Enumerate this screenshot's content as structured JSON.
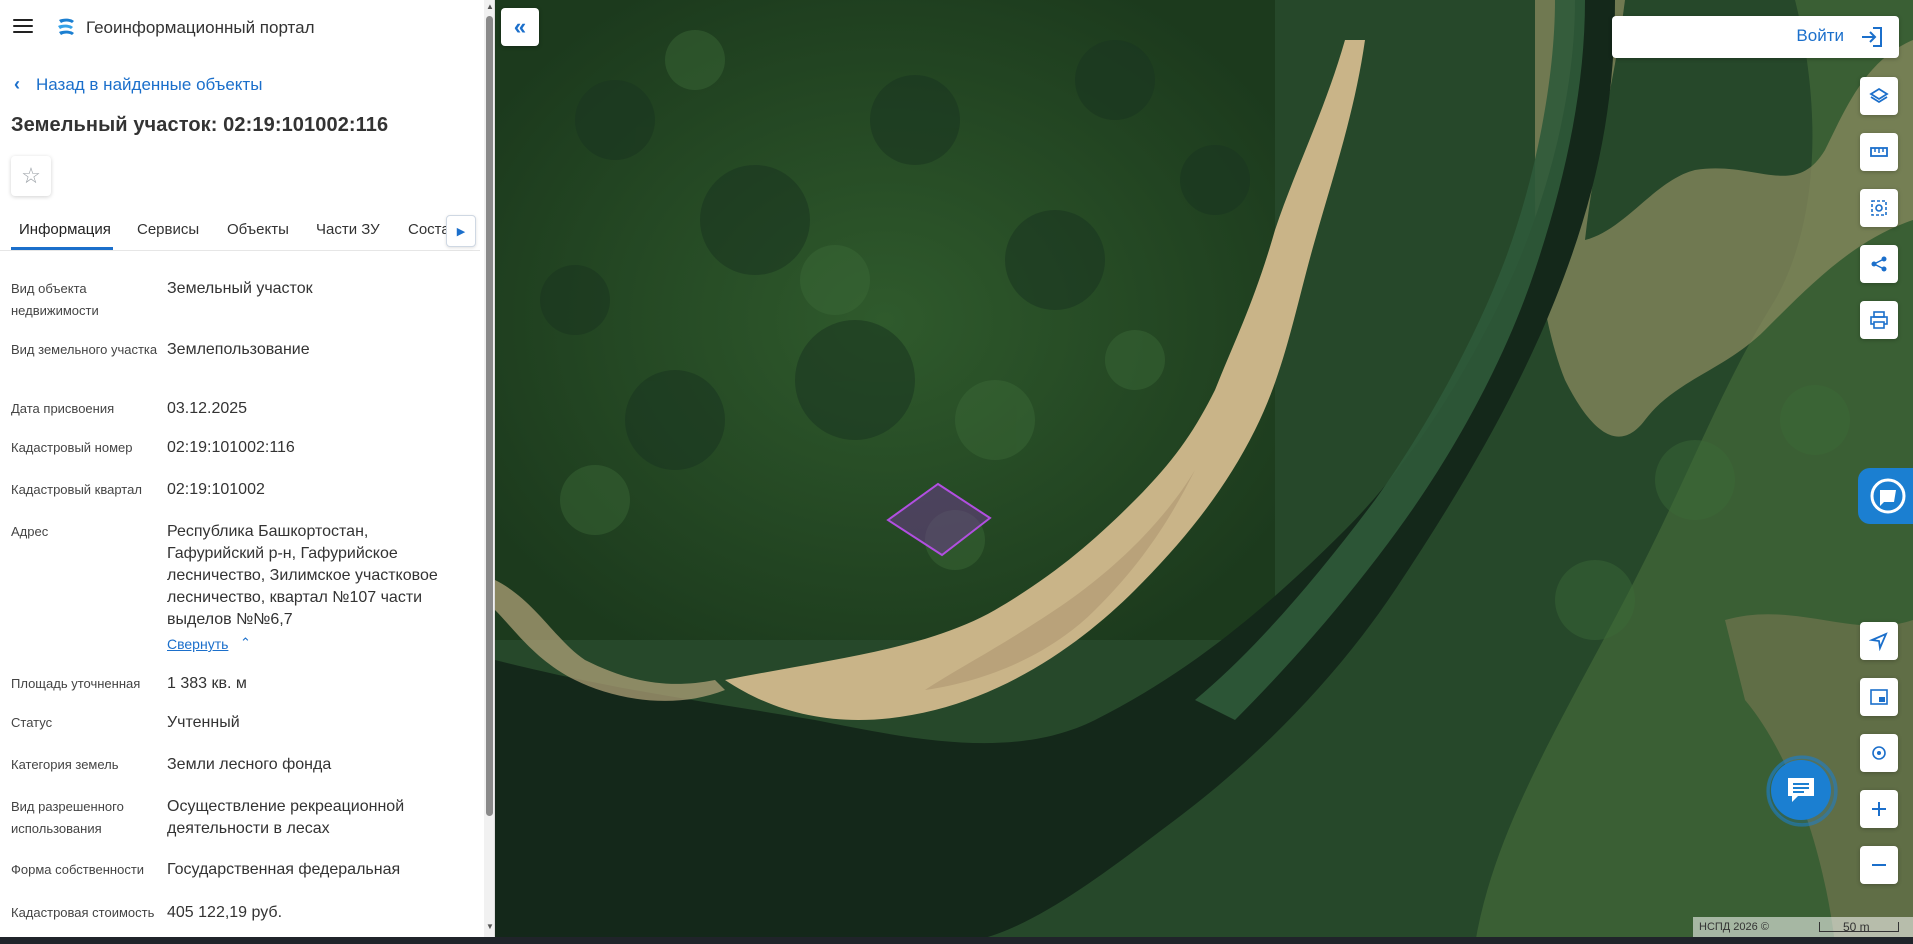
{
  "app": {
    "title": "Геоинформационный портал",
    "icon": "portal-logo-icon"
  },
  "nav": {
    "back_label": "Назад в найденные объекты"
  },
  "object": {
    "title": "Земельный участок: 02:19:101002:116"
  },
  "tabs": [
    {
      "label": "Информация",
      "active": true
    },
    {
      "label": "Сервисы"
    },
    {
      "label": "Объекты"
    },
    {
      "label": "Части ЗУ"
    },
    {
      "label": "Состав"
    }
  ],
  "info": {
    "rows": [
      {
        "label": "Вид объекта недвижимости",
        "value": "Земельный участок"
      },
      {
        "label": "Вид земельного участка",
        "value": "Землепользование"
      },
      {
        "label": "Дата присвоения",
        "value": "03.12.2025"
      },
      {
        "label": "Кадастровый номер",
        "value": "02:19:101002:116"
      },
      {
        "label": "Кадастровый квартал",
        "value": "02:19:101002"
      },
      {
        "label": "Адрес",
        "value": "Республика Башкортостан, Гафурийский р-н, Гафурийское лесничество, Зилимское участковое лесничество, квартал №107 части выделов №№6,7"
      },
      {
        "label": "Площадь уточненная",
        "value": "1 383 кв. м"
      },
      {
        "label": "Статус",
        "value": "Учтенный"
      },
      {
        "label": "Категория земель",
        "value": "Земли лесного фонда"
      },
      {
        "label": "Вид разрешенного использования",
        "value": "Осуществление рекреационной деятельности в лесах"
      },
      {
        "label": "Форма собственности",
        "value": "Государственная федеральная"
      },
      {
        "label": "Кадастровая стоимость",
        "value": "405 122,19 руб."
      }
    ],
    "collapse_label": "Свернуть"
  },
  "map": {
    "login_label": "Войти",
    "attribution": "НСПД 2026 ©",
    "scale_label": "50 m",
    "parcel_color": "#9b3fc4"
  },
  "tools": [
    {
      "name": "layers-icon"
    },
    {
      "name": "ruler-icon"
    },
    {
      "name": "area-select-icon"
    },
    {
      "name": "share-icon"
    },
    {
      "name": "print-icon"
    },
    {
      "name": "navigate-icon"
    },
    {
      "name": "minimap-icon"
    },
    {
      "name": "locate-icon"
    },
    {
      "name": "zoom-in-icon"
    },
    {
      "name": "zoom-out-icon"
    }
  ]
}
